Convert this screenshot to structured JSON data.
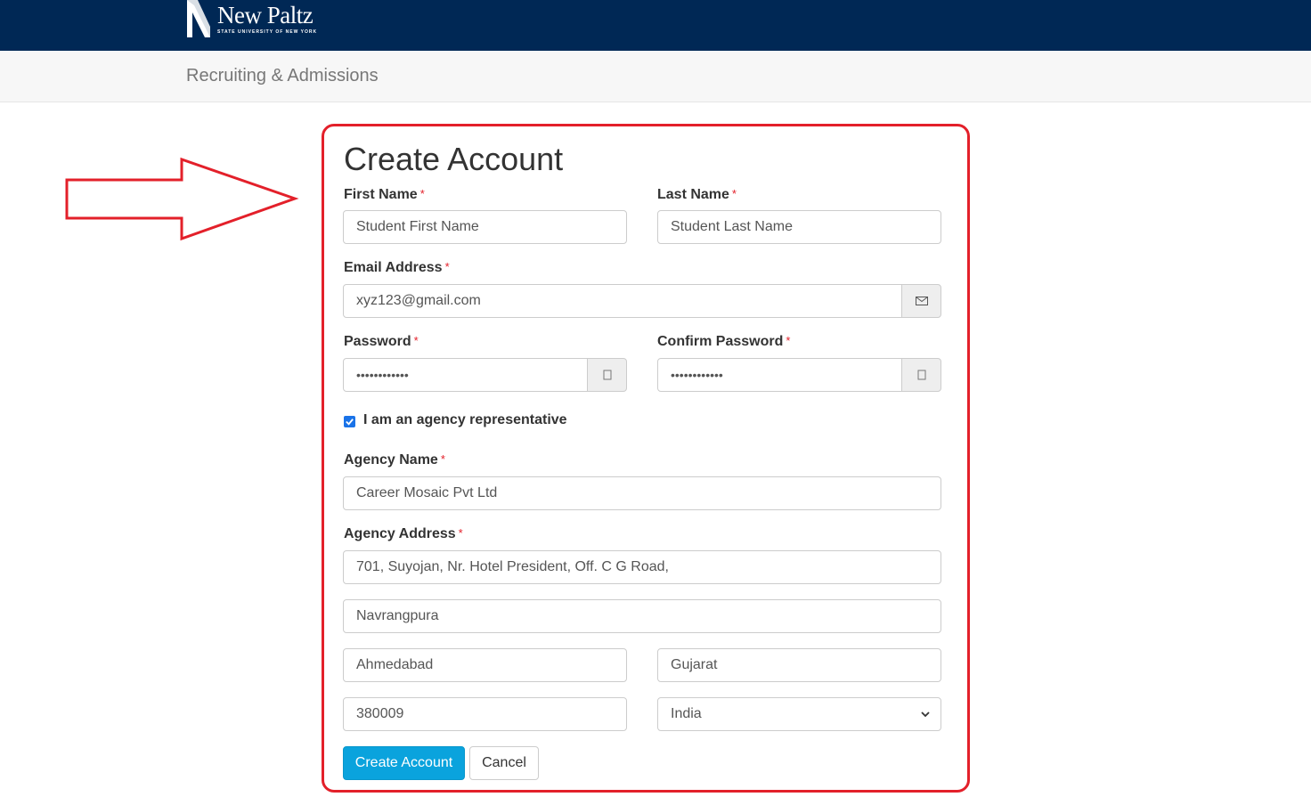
{
  "header": {
    "logo_name": "New Paltz",
    "logo_subtitle": "STATE UNIVERSITY OF NEW YORK",
    "background": "#002855"
  },
  "subheader": {
    "title": "Recruiting & Admissions"
  },
  "form": {
    "title": "Create Account",
    "required_marker": "*",
    "first_name": {
      "label": "First Name",
      "placeholder": "Student First Name"
    },
    "last_name": {
      "label": "Last Name",
      "placeholder": "Student Last Name"
    },
    "email": {
      "label": "Email Address",
      "value": "xyz123@gmail.com",
      "icon": "envelope-icon"
    },
    "password": {
      "label": "Password",
      "value": "••••••••••••",
      "icon": "eye-icon"
    },
    "confirm_password": {
      "label": "Confirm Password",
      "value": "••••••••••••",
      "icon": "eye-icon"
    },
    "agency_checkbox": {
      "label": "I am an agency representative",
      "checked": true
    },
    "agency_name": {
      "label": "Agency Name",
      "value": "Career Mosaic Pvt Ltd"
    },
    "agency_address": {
      "label": "Agency Address",
      "line1": "701, Suyojan, Nr. Hotel President, Off. C G Road,",
      "line2": "Navrangpura",
      "city": "Ahmedabad",
      "state": "Gujarat",
      "postal_code": "380009",
      "country": "India"
    },
    "buttons": {
      "create": "Create Account",
      "cancel": "Cancel"
    }
  },
  "annotation": {
    "highlight_color": "#e3202a"
  },
  "colors": {
    "primary_button": "#0aa3dd",
    "required": "#e3202a"
  }
}
